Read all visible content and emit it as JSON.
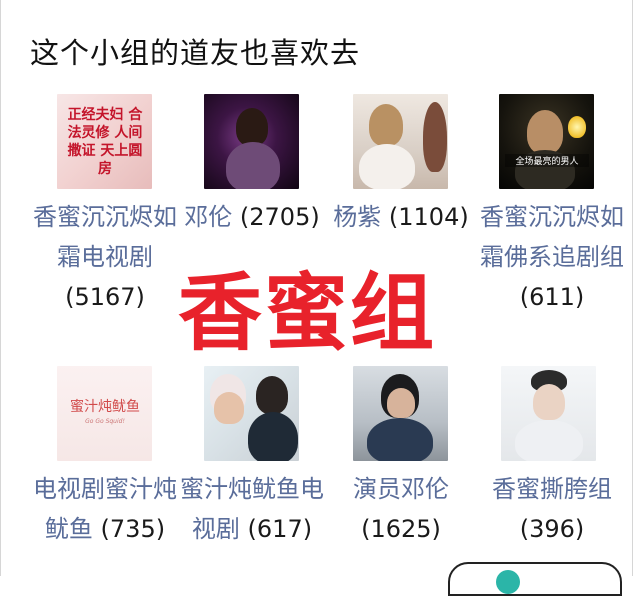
{
  "section_title": "这个小组的道友也喜欢去",
  "groups": [
    {
      "name": "香蜜沉沉烬如霜电视剧",
      "count": "(5167)",
      "thumb_text": "正经夫妇 合法灵修 人间撒证 天上圆房"
    },
    {
      "name": "邓伦",
      "count": "(2705)"
    },
    {
      "name": "杨紫",
      "count": "(1104)"
    },
    {
      "name": "香蜜沉沉烬如霜佛系追剧组",
      "count": "(611)",
      "thumb_text": "全场最亮的男人"
    },
    {
      "name": "电视剧蜜汁炖鱿鱼",
      "count": "(735)",
      "thumb_text": "蜜汁炖鱿鱼",
      "thumb_sub": "Go Go Squid!"
    },
    {
      "name": "蜜汁炖鱿鱼电视剧",
      "count": "(617)"
    },
    {
      "name": "演员邓伦",
      "count": "(1625)"
    },
    {
      "name": "香蜜撕胯组",
      "count": "(396)"
    }
  ],
  "overlay_watermark": "香蜜组",
  "colors": {
    "name": "#5a6d9a",
    "count": "#1a1a1a",
    "watermark": "#e8222b"
  }
}
